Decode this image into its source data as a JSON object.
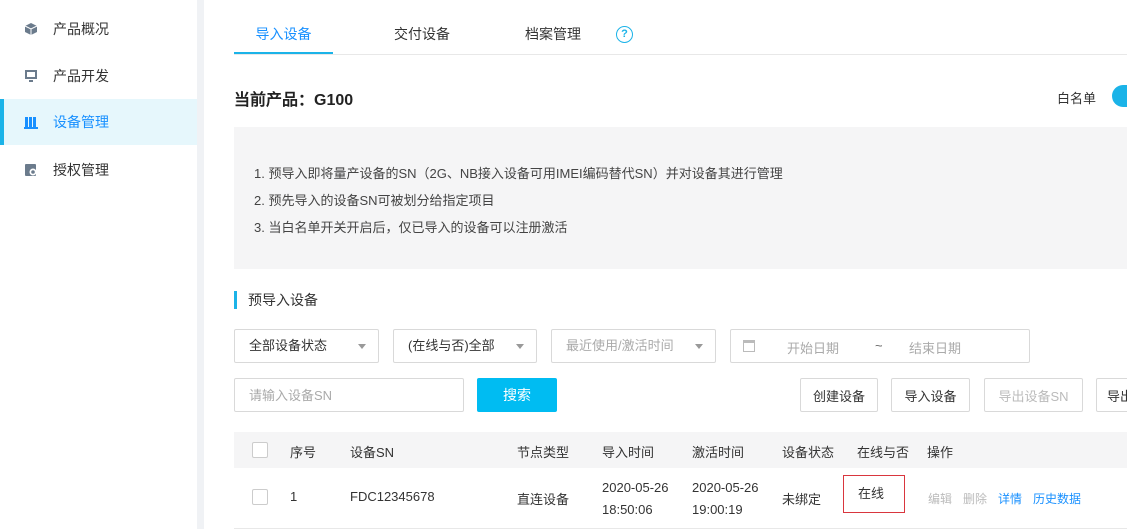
{
  "sidebar": {
    "items": [
      {
        "label": "产品概况",
        "icon": "cube-icon"
      },
      {
        "label": "产品开发",
        "icon": "monitor-icon"
      },
      {
        "label": "设备管理",
        "icon": "books-icon",
        "active": true
      },
      {
        "label": "授权管理",
        "icon": "gear-doc-icon"
      }
    ]
  },
  "tabs": [
    {
      "label": "导入设备",
      "active": true
    },
    {
      "label": "交付设备"
    },
    {
      "label": "档案管理"
    }
  ],
  "help_icon": "?",
  "product_title": "当前产品：G100",
  "whitelist": {
    "label": "白名单",
    "enabled": true
  },
  "notice": [
    "1. 预导入即将量产设备的SN（2G、NB接入设备可用IMEI编码替代SN）并对设备其进行管理",
    "2. 预先导入的设备SN可被划分给指定项目",
    "3. 当白名单开关开启后，仅已导入的设备可以注册激活"
  ],
  "section_title": "预导入设备",
  "filters": {
    "status": "全部设备状态",
    "online": "(在线与否)全部",
    "time": "最近使用/激活时间",
    "start_date": "开始日期",
    "separator": "~",
    "end_date": "结束日期"
  },
  "search": {
    "placeholder": "请输入设备SN",
    "button": "搜索"
  },
  "actions": {
    "create": "创建设备",
    "import": "导入设备",
    "export_sn": "导出设备SN",
    "export": "导出"
  },
  "table": {
    "headers": [
      "序号",
      "设备SN",
      "节点类型",
      "导入时间",
      "激活时间",
      "设备状态",
      "在线与否",
      "操作"
    ],
    "rows": [
      {
        "index": "1",
        "sn": "FDC12345678",
        "node_type": "直连设备",
        "import_date": "2020-05-26",
        "import_time": "18:50:06",
        "activate_date": "2020-05-26",
        "activate_time": "19:00:19",
        "status": "未绑定",
        "online": "在线",
        "ops": {
          "edit": "编辑",
          "delete": "删除",
          "detail": "详情",
          "history": "历史数据"
        }
      }
    ]
  },
  "colors": {
    "accent": "#1bb3e8",
    "primary_button": "#00bcf2",
    "link": "#1890ff",
    "highlight_border": "#d9363e"
  }
}
